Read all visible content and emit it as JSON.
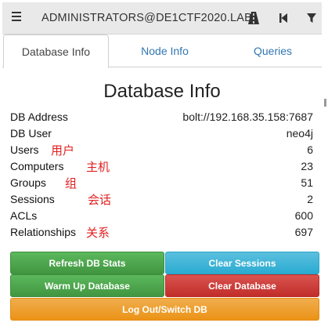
{
  "header": {
    "title": "ADMINISTRATORS@DE1CTF2020.LAB",
    "menu_icon": "hamburger-menu-icon",
    "path_icon": "road-pathfinding-icon",
    "back_icon": "step-backward-icon",
    "filter_icon": "filter-icon"
  },
  "tabs": [
    {
      "label": "Database Info"
    },
    {
      "label": "Node Info"
    },
    {
      "label": "Queries"
    }
  ],
  "main": {
    "heading": "Database Info",
    "rows": [
      {
        "label": "DB Address",
        "value": "bolt://192.168.35.158:7687",
        "note": ""
      },
      {
        "label": "DB User",
        "value": "neo4j",
        "note": ""
      },
      {
        "label": "Users",
        "value": "6",
        "note": "用户"
      },
      {
        "label": "Computers",
        "value": "23",
        "note": "主机"
      },
      {
        "label": "Groups",
        "value": "51",
        "note": "组"
      },
      {
        "label": "Sessions",
        "value": "2",
        "note": "会话"
      },
      {
        "label": "ACLs",
        "value": "600",
        "note": ""
      },
      {
        "label": "Relationships",
        "value": "697",
        "note": "关系"
      }
    ]
  },
  "buttons": {
    "refresh": "Refresh DB Stats",
    "clear_sessions": "Clear Sessions",
    "warm_up": "Warm Up Database",
    "clear_database": "Clear Database",
    "logout": "Log Out/Switch DB"
  },
  "colors": {
    "green": "#5cb85c",
    "blue": "#5bc0de",
    "red": "#d9534f",
    "orange": "#f0ad4e",
    "link": "#3376b2",
    "annotation": "#e02020"
  }
}
